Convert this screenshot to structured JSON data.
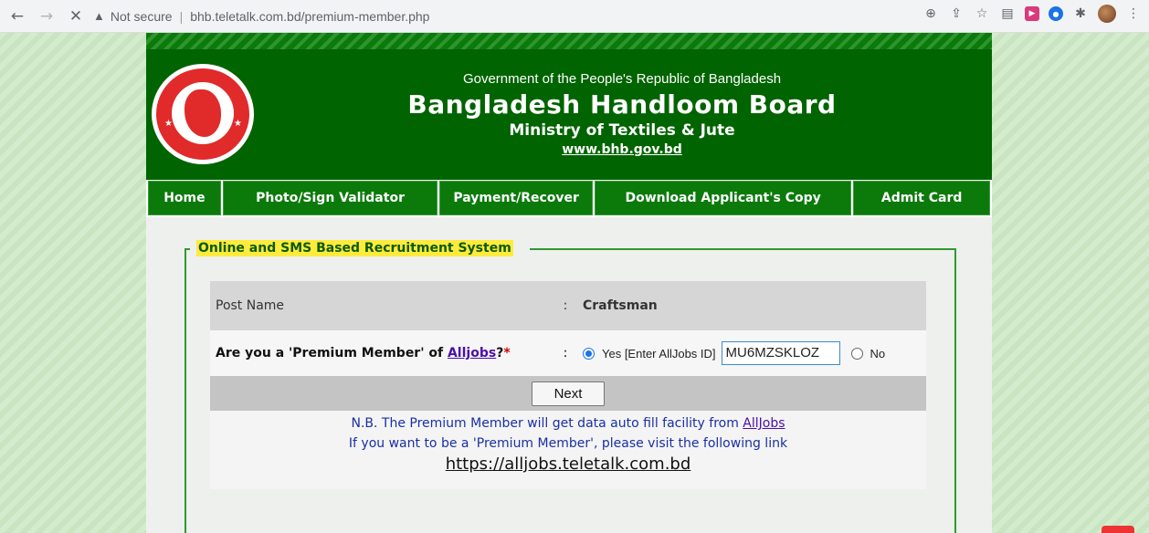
{
  "browser": {
    "security_label": "Not secure",
    "url": "bhb.teletalk.com.bd/premium-member.php"
  },
  "header": {
    "government": "Government of the People's Republic of Bangladesh",
    "board": "Bangladesh Handloom Board",
    "ministry": "Ministry of Textiles & Jute",
    "website": "www.bhb.gov.bd"
  },
  "menu": [
    "Home",
    "Photo/Sign Validator",
    "Payment/Recover",
    "Download Applicant's Copy",
    "Admit Card"
  ],
  "form": {
    "legend": "Online and SMS Based Recruitment System",
    "post_label": "Post Name",
    "colon": ":",
    "post_value": "Craftsman",
    "premium_question_prefix": "Are you a 'Premium Member' of ",
    "premium_question_link": "Alljobs",
    "premium_question_suffix": "?",
    "required_mark": "*",
    "yes_label": "Yes [Enter AllJobs ID]",
    "alljobs_id": "MU6MZSKLOZ",
    "no_label": "No",
    "selected": "yes",
    "next_label": "Next"
  },
  "note": {
    "line1_prefix": "N.B. The Premium Member will get data auto fill facility from ",
    "line1_link": "AllJobs",
    "line2": "If you want to be a 'Premium Member', please visit the following link",
    "link": "https://alljobs.teletalk.com.bd"
  }
}
